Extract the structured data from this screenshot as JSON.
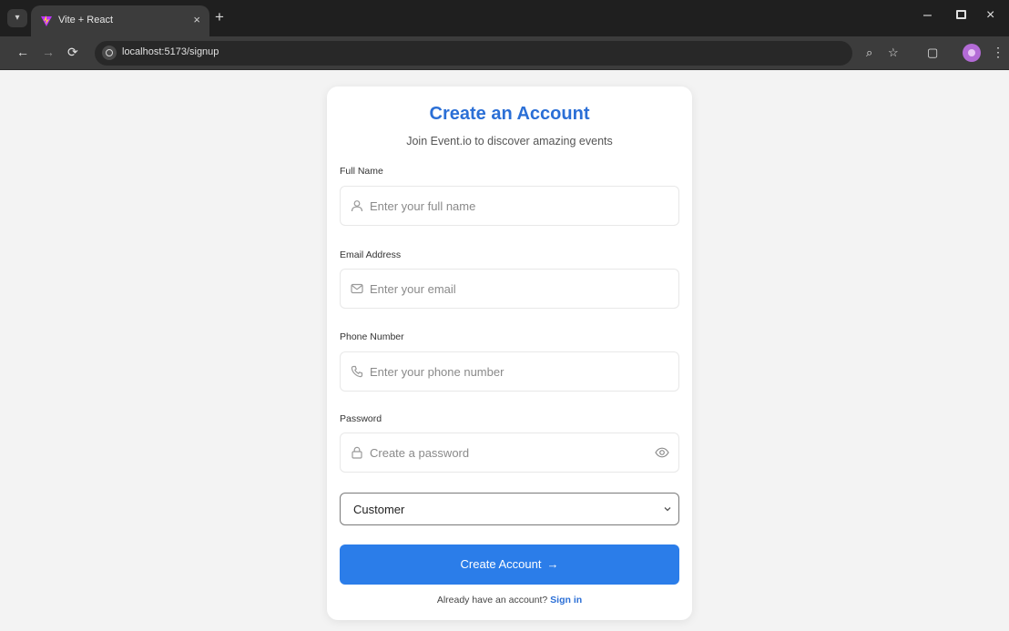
{
  "browser": {
    "tab_title": "Vite + React",
    "tab_close": "×",
    "new_tab": "+",
    "back": "←",
    "forward": "→",
    "reload": "⟳",
    "url": "localhost:5173/signup",
    "zoom_icon": "⌕",
    "star_icon": "☆",
    "extensions_icon": "▢",
    "menu": "⋮",
    "window_min": "–",
    "window_close": "×"
  },
  "signup": {
    "title": "Create an Account",
    "subtitle": "Join Event.io to discover amazing events",
    "fields": {
      "full_name": {
        "label": "Full Name",
        "placeholder": "Enter your full name",
        "value": ""
      },
      "email": {
        "label": "Email Address",
        "placeholder": "Enter your email",
        "value": ""
      },
      "phone": {
        "label": "Phone Number",
        "placeholder": "Enter your phone number",
        "value": ""
      },
      "password": {
        "label": "Password",
        "placeholder": "Create a password",
        "value": ""
      }
    },
    "role_select": {
      "value": "Customer"
    },
    "submit_label": "Create Account",
    "submit_arrow": "→",
    "footer_text": "Already have an account?",
    "signin_label": "Sign in"
  },
  "colors": {
    "accent": "#2b7de9",
    "title": "#2b6fd6",
    "page_bg": "#f3f3f3",
    "chrome_dark": "#1f1f1f",
    "toolbar": "#3c3c3c"
  },
  "icons": {
    "full_name": "user-icon",
    "email": "mail-icon",
    "phone": "phone-icon",
    "password": "lock-icon",
    "password_toggle": "eye-icon"
  }
}
